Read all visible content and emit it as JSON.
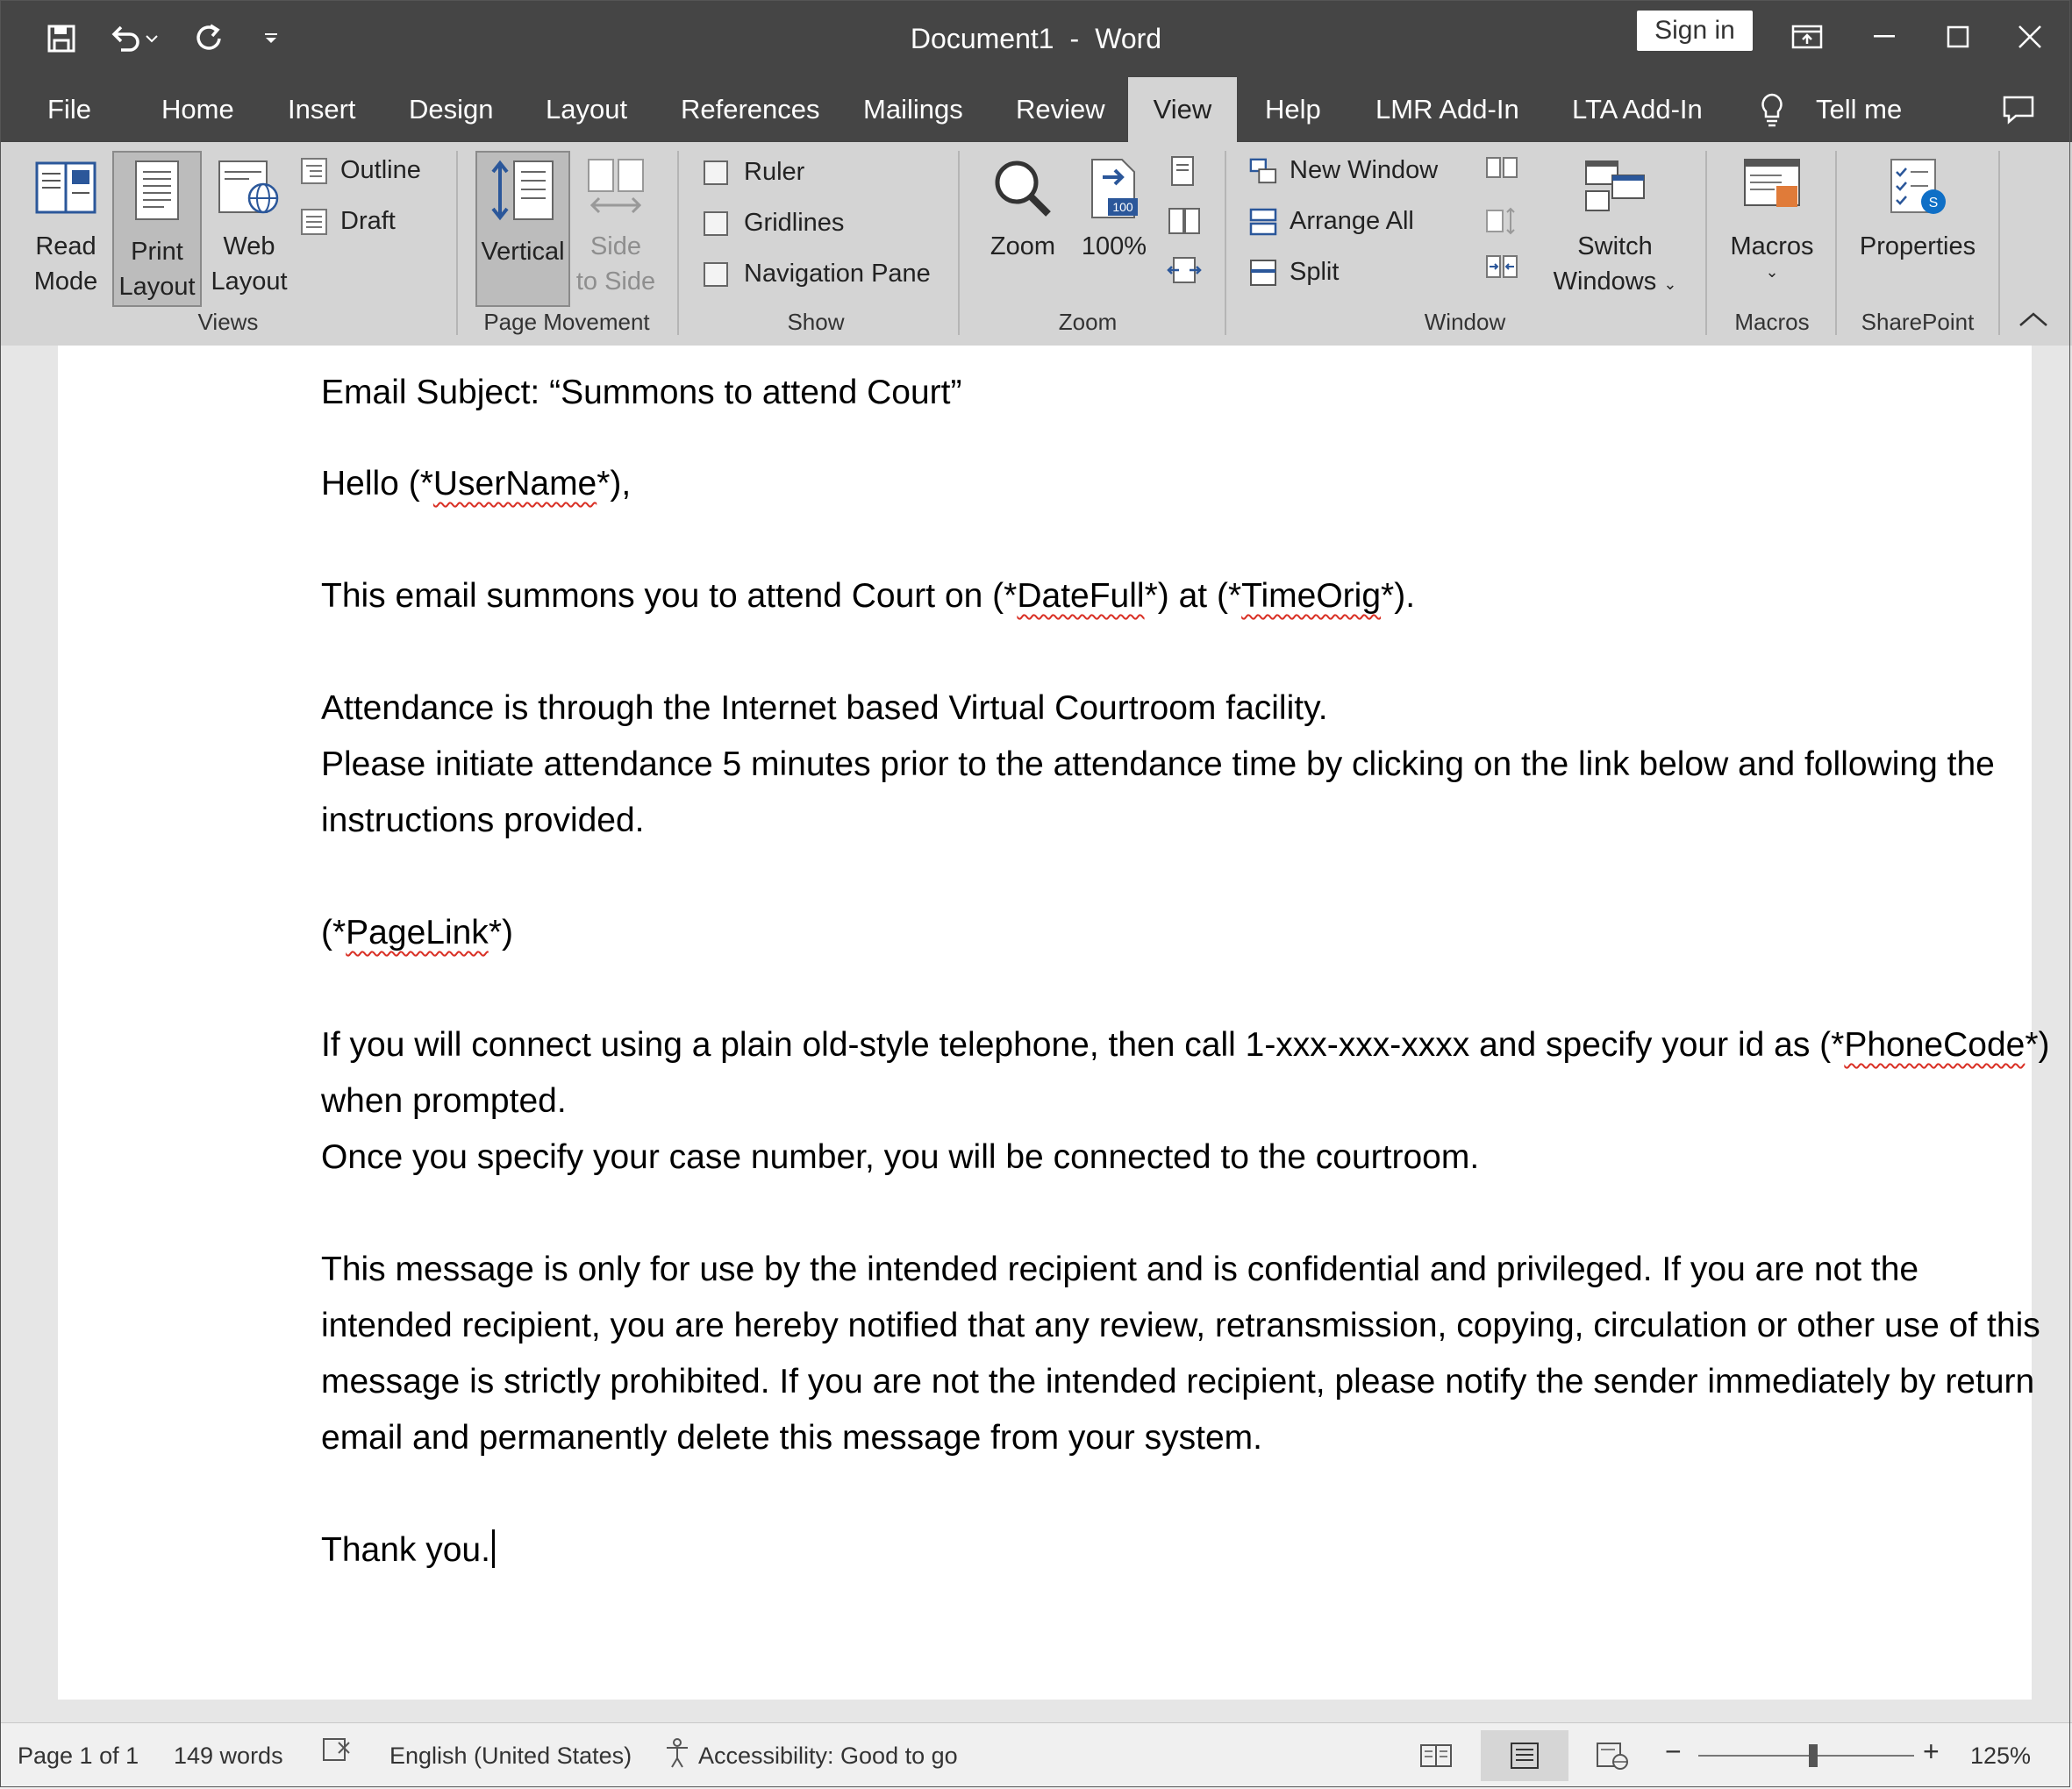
{
  "titlebar": {
    "doc_name": "Document1",
    "separator": "-",
    "app_name": "Word",
    "sign_in": "Sign in"
  },
  "tabs": [
    "File",
    "Home",
    "Insert",
    "Design",
    "Layout",
    "References",
    "Mailings",
    "Review",
    "View",
    "Help",
    "LMR Add-In",
    "LTA Add-In",
    "Tell me"
  ],
  "active_tab": "View",
  "ribbon": {
    "views": {
      "read_mode_1": "Read",
      "read_mode_2": "Mode",
      "print_layout_1": "Print",
      "print_layout_2": "Layout",
      "web_layout_1": "Web",
      "web_layout_2": "Layout",
      "outline": "Outline",
      "draft": "Draft",
      "group": "Views"
    },
    "page_movement": {
      "vertical": "Vertical",
      "side_1": "Side",
      "side_2": "to Side",
      "group": "Page Movement"
    },
    "show": {
      "ruler": "Ruler",
      "gridlines": "Gridlines",
      "navigation_pane": "Navigation Pane",
      "group": "Show"
    },
    "zoom": {
      "zoom": "Zoom",
      "hundred": "100%",
      "badge": "100",
      "group": "Zoom"
    },
    "window": {
      "new_window": "New Window",
      "arrange_all": "Arrange All",
      "split": "Split",
      "switch_1": "Switch",
      "switch_2": "Windows",
      "group": "Window"
    },
    "macros": {
      "label": "Macros",
      "group": "Macros"
    },
    "sharepoint": {
      "label": "Properties",
      "group": "SharePoint"
    }
  },
  "document": {
    "subject": "Email Subject: “Summons to attend Court”",
    "greeting_pre": "Hello (*",
    "greeting_var": "UserName",
    "greeting_post": "*),",
    "line1_a": "This email summons you to attend Court on (*",
    "line1_var1": "DateFull",
    "line1_b": "*) at (*",
    "line1_var2": "TimeOrig",
    "line1_c": "*).",
    "line2": "Attendance is through the Internet based Virtual Courtroom facility.",
    "line3": "Please initiate attendance 5 minutes prior to the attendance time by clicking on the link below and following the instructions provided.",
    "link_pre": "(*",
    "link_var": "PageLink",
    "link_post": "*)",
    "phone_a": "If you will connect using a plain old-style telephone, then call 1-xxx-xxx-xxxx and specify your id as (*",
    "phone_var": "PhoneCode",
    "phone_b": "*) when prompted.",
    "line4": "Once you specify your case number, you will be connected to the courtroom.",
    "disclaimer": "This message is only for use by the intended recipient and is confidential and privileged. If you are not the intended recipient, you are hereby notified that any review, retransmission, copying, circulation or other use of this message is strictly prohibited. If you are not the intended recipient, please notify the sender immediately by return email and permanently delete this message from your system.",
    "thanks": "Thank you."
  },
  "status": {
    "page": "Page 1 of 1",
    "words": "149 words",
    "language": "English (United States)",
    "accessibility": "Accessibility: Good to go",
    "zoom": "125%",
    "zoom_level_percent": 125
  },
  "colors": {
    "titlebar": "#454545",
    "ribbon": "#d4d4d4",
    "accent": "#2b579a",
    "sharepoint": "#0f6fc6"
  }
}
